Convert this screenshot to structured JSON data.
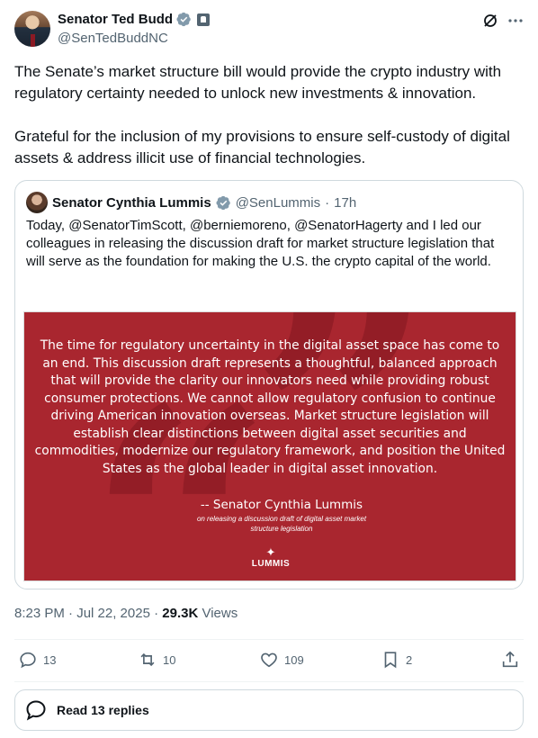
{
  "author": {
    "display_name": "Senator Ted Budd",
    "handle": "@SenTedBuddNC"
  },
  "tweet": {
    "paragraphs": [
      "The Senate’s market structure bill would provide the crypto industry with regulatory certainty needed to unlock new investments & innovation.",
      "Grateful for the inclusion of my provisions to ensure self-custody of digital assets & address illicit use of financial technologies."
    ]
  },
  "quoted": {
    "display_name": "Senator Cynthia Lummis",
    "handle": "@SenLummis",
    "separator": "·",
    "time": "17h",
    "text": "Today, @SenatorTimScott, @berniemoreno, @SenatorHagerty and I led our colleagues in releasing the discussion draft for market structure legislation that will serve as the foundation for making the U.S. the crypto capital of the world.",
    "image": {
      "quote": "The time for regulatory uncertainty in the digital asset space has come to an end. This discussion draft represents a thoughtful, balanced approach that will provide the clarity our innovators need while providing robust consumer protections. We cannot allow regulatory confusion to continue driving American innovation overseas. Market structure legislation will establish clear distinctions between digital asset securities and commodities, modernize our regulatory framework, and position the United States as the global leader in digital asset innovation.",
      "attribution": "-- Senator Cynthia Lummis",
      "attribution_note": "on releasing a discussion draft of digital asset market structure legislation",
      "logo_text": "LUMMIS",
      "background_color": "#a9262f"
    }
  },
  "meta": {
    "timestamp": "8:23 PM · Jul 22, 2025",
    "separator": "·",
    "views_count": "29.3K",
    "views_label": "Views"
  },
  "actions": {
    "replies": "13",
    "reposts": "10",
    "likes": "109",
    "bookmarks": "2"
  },
  "read_replies_label": "Read 13 replies",
  "colors": {
    "verified_blue": "#1d9bf0",
    "text_primary": "#0f1419",
    "text_secondary": "#536471"
  },
  "icons": [
    "verified-badge-icon",
    "government-badge-icon",
    "grok-icon",
    "more-icon",
    "reply-icon",
    "repost-icon",
    "like-icon",
    "bookmark-icon",
    "share-icon",
    "chat-bubble-icon"
  ]
}
